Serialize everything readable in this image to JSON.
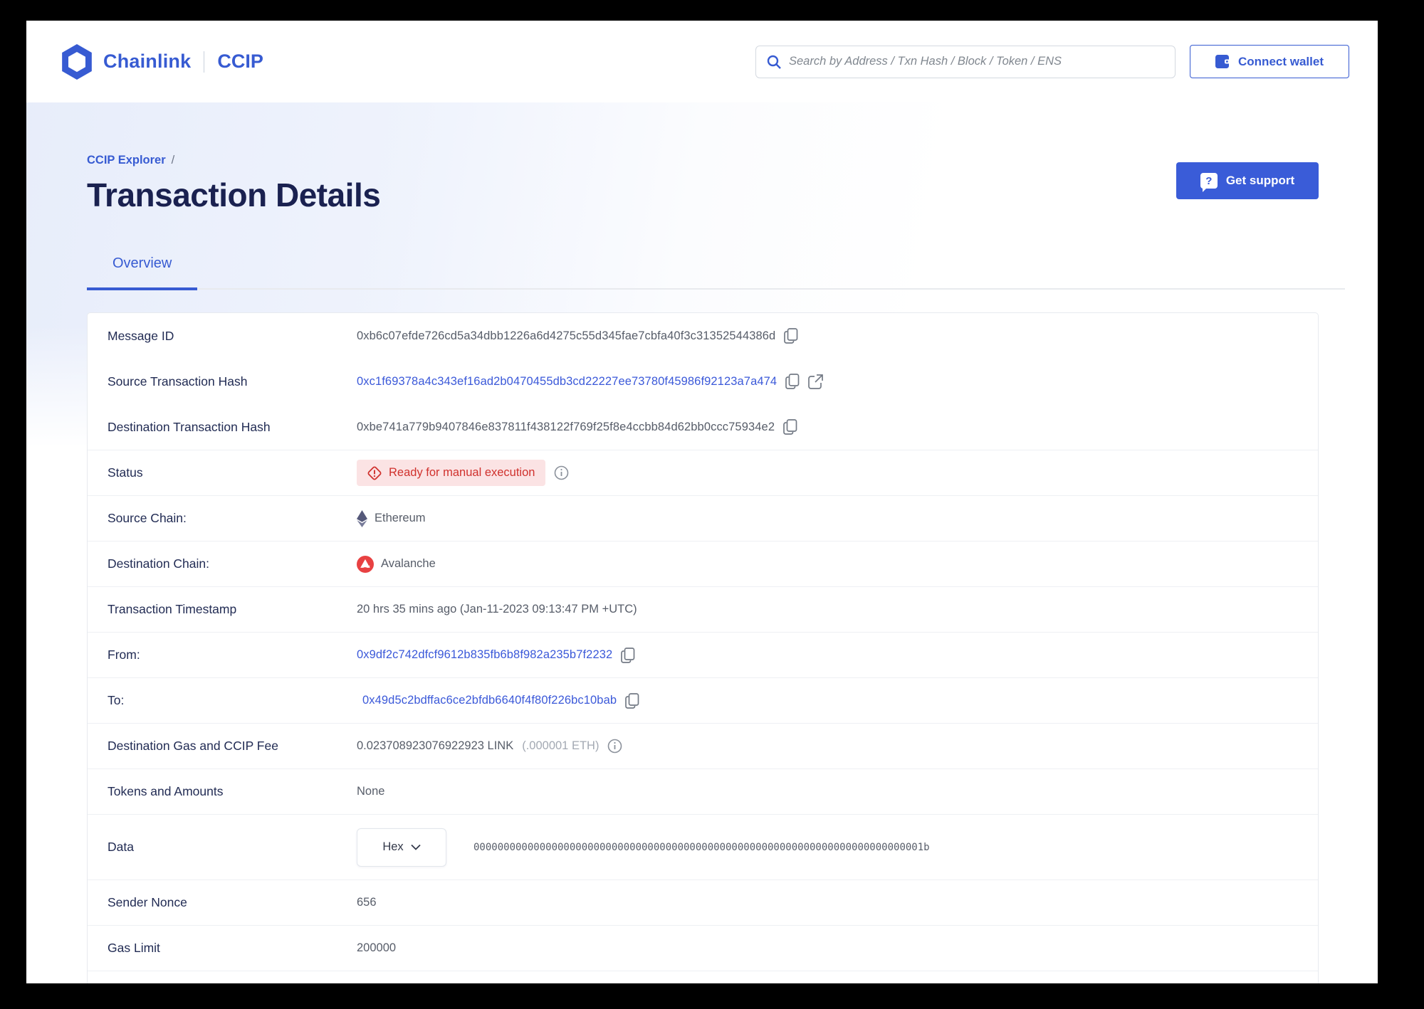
{
  "header": {
    "brand": {
      "name": "Chainlink",
      "product": "CCIP"
    },
    "search": {
      "placeholder": "Search by Address / Txn Hash / Block / Token / ENS"
    },
    "connect_wallet_label": "Connect wallet"
  },
  "hero": {
    "breadcrumb": {
      "link": "CCIP Explorer",
      "separator": "/"
    },
    "title": "Transaction Details",
    "get_support_label": "Get support",
    "get_support_icon_glyph": "?"
  },
  "tabs": [
    {
      "label": "Overview",
      "active": true
    }
  ],
  "details": {
    "message_id": {
      "label": "Message ID",
      "value": "0xb6c07efde726cd5a34dbb1226a6d4275c55d345fae7cbfa40f3c31352544386d"
    },
    "source_tx_hash": {
      "label": "Source Transaction Hash",
      "value": "0xc1f69378a4c343ef16ad2b0470455db3cd22227ee73780f45986f92123a7a474"
    },
    "dest_tx_hash": {
      "label": "Destination Transaction Hash",
      "value": "0xbe741a779b9407846e837811f438122f769f25f8e4ccbb84d62bb0ccc75934e2"
    },
    "status": {
      "label": "Status",
      "badge": "Ready for manual execution"
    },
    "source_chain": {
      "label": "Source Chain:",
      "value": "Ethereum"
    },
    "dest_chain": {
      "label": "Destination Chain:",
      "value": "Avalanche"
    },
    "timestamp": {
      "label": "Transaction Timestamp",
      "value": "20 hrs 35 mins ago (Jan-11-2023 09:13:47 PM +UTC)"
    },
    "from": {
      "label": "From:",
      "value": "0x9df2c742dfcf9612b835fb6b8f982a235b7f2232"
    },
    "to": {
      "label": "To:",
      "value": "0x49d5c2bdffac6ce2bfdb6640f4f80f226bc10bab"
    },
    "fee": {
      "label": "Destination Gas and CCIP Fee",
      "value": "0.023708923076922923 LINK",
      "secondary": "(.000001 ETH)"
    },
    "tokens": {
      "label": "Tokens and Amounts",
      "value": "None"
    },
    "data": {
      "label": "Data",
      "format_selected": "Hex",
      "value": "000000000000000000000000000000000000000000000000000000000000000000000000001b"
    },
    "sender_nonce": {
      "label": "Sender Nonce",
      "value": "656"
    },
    "gas_limit": {
      "label": "Gas Limit",
      "value": "200000"
    }
  },
  "colors": {
    "brand_blue": "#375bd2",
    "link_blue": "#3b59d9",
    "title_navy": "#1a2150",
    "status_red": "#d0312d",
    "status_bg": "#fbe3e4",
    "avalanche_red": "#e84142",
    "value_gray": "#575d69"
  }
}
